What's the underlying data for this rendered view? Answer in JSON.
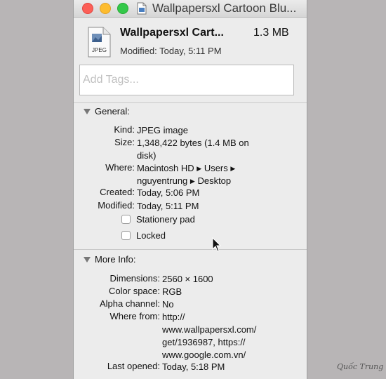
{
  "window": {
    "title": "Wallpapersxl Cartoon Blu..."
  },
  "header": {
    "file_name": "Wallpapersxl Cart...",
    "file_size": "1.3 MB",
    "modified": "Modified: Today, 5:11 PM",
    "icon_label": "JPEG",
    "icon": "jpeg-file-icon"
  },
  "tags": {
    "placeholder": "Add Tags..."
  },
  "general": {
    "heading": "General:",
    "kind_label": "Kind:",
    "kind": "JPEG image",
    "size_label": "Size:",
    "size_line1": "1,348,422 bytes (1.4 MB on",
    "size_line2": "disk)",
    "where_label": "Where:",
    "where_line1_a": "Macintosh HD",
    "where_line1_b": "Users",
    "where_line2_a": "nguyentrung",
    "where_line2_b": "Desktop",
    "created_label": "Created:",
    "created": "Today, 5:06 PM",
    "modified_label": "Modified:",
    "modified": "Today, 5:11 PM",
    "stationery_label": "Stationery pad",
    "locked_label": "Locked"
  },
  "more_info": {
    "heading": "More Info:",
    "dimensions_label": "Dimensions:",
    "dimensions": "2560 × 1600",
    "color_space_label": "Color space:",
    "color_space": "RGB",
    "alpha_label": "Alpha channel:",
    "alpha": "No",
    "where_from_label": "Where from:",
    "where_from_line1": "http://",
    "where_from_line2": "www.wallpapersxl.com/",
    "where_from_line3": "get/1936987, https://",
    "where_from_line4": "www.google.com.vn/",
    "last_opened_label": "Last opened:",
    "last_opened": "Today, 5:18 PM"
  },
  "watermark": "Quốc Trung",
  "colors": {
    "close": "#fc5f57",
    "minimize": "#fdbc2e",
    "maximize": "#34c84a",
    "background": "#b8b5b6",
    "panel": "#ececec"
  }
}
